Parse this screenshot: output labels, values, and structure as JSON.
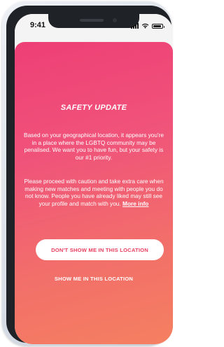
{
  "status_bar": {
    "time": "9:41",
    "icons": [
      "cellular-signal-icon",
      "wifi-icon",
      "battery-icon"
    ]
  },
  "modal": {
    "title": "SAFETY UPDATE",
    "paragraph_1": "Based on your geographical location, it appears you're in a place where the LGBTQ community may be penalised. We want you to have fun, but your safety is our #1 priority.",
    "paragraph_2": "Please proceed with caution and take extra care when making new matches and meeting with people you do not know. People you have already liked may still see your profile and match with you.",
    "more_info_link": "More info",
    "primary_button": "DON'T SHOW ME IN THIS LOCATION",
    "secondary_button": "SHOW ME IN THIS LOCATION"
  },
  "colors": {
    "gradient_top": "#ee3f76",
    "gradient_bottom": "#f58060",
    "primary_button_text": "#e9405f",
    "text": "#ffffff"
  }
}
